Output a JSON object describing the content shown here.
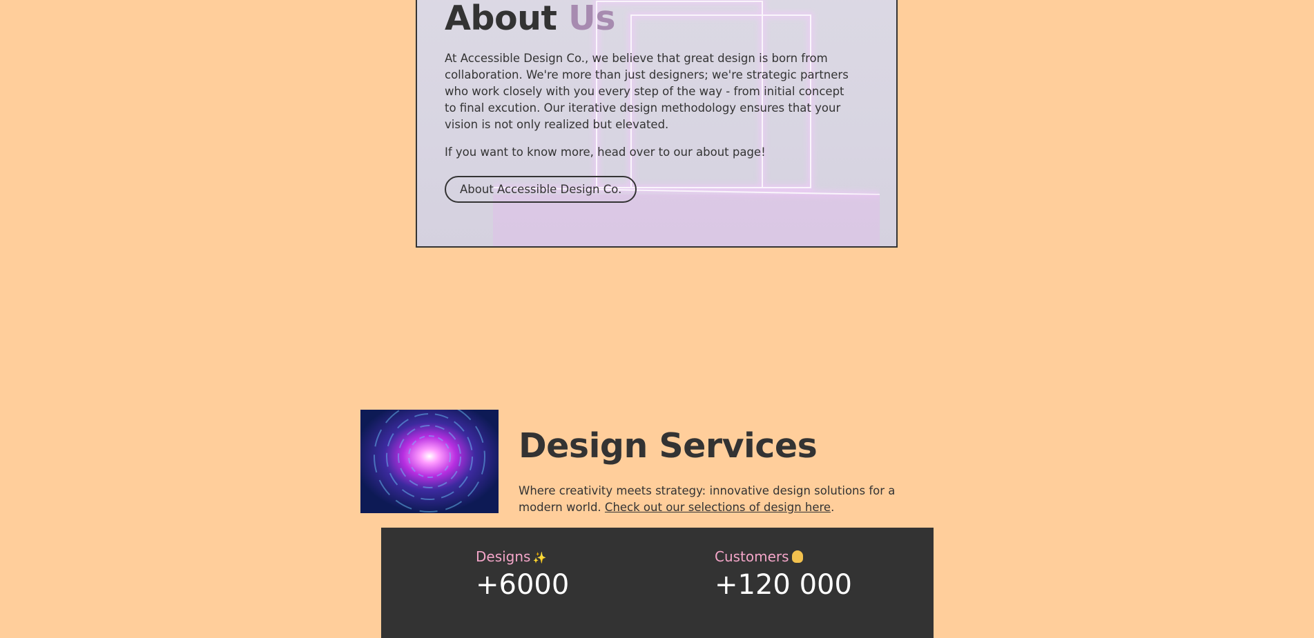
{
  "about": {
    "title_main": "About",
    "title_accent": "Us",
    "paragraph1": "At Accessible Design Co., we believe that great design is born from collaboration. We're more than just designers; we're strategic partners who work closely with you every step of the way - from initial concept to final excution. Our iterative design methodology ensures that your vision is not only realized but elevated.",
    "paragraph2": "If you want to know more, head over to our about page!",
    "button_label": "About Accessible Design Co."
  },
  "services": {
    "title": "Design Services",
    "description": "Where creativity meets strategy: innovative design solutions for a modern world.",
    "link_text": "Check out our selections of design here",
    "link_suffix": "."
  },
  "stats": [
    {
      "label": "Designs",
      "icon": "sparkles-icon",
      "value": "+6000"
    },
    {
      "label": "Customers",
      "icon": "person-icon",
      "value": "+120 000"
    }
  ],
  "colors": {
    "background": "#ffce9b",
    "text": "#333333",
    "accent_purple": "#a78bb0",
    "stats_background": "#333333",
    "stat_label": "#f4a6c9"
  }
}
